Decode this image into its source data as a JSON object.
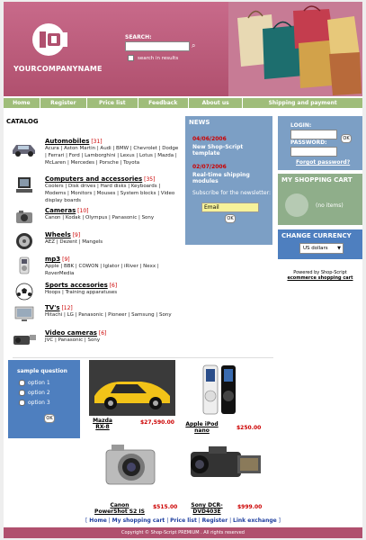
{
  "header": {
    "company": "YOURCOMPANYNAME",
    "search_label": "SEARCH:",
    "search_value": "",
    "search_in_results": "search in results"
  },
  "nav": [
    {
      "label": "Home"
    },
    {
      "label": "Register"
    },
    {
      "label": "Price list"
    },
    {
      "label": "Feedback"
    },
    {
      "label": "About us"
    },
    {
      "label": "Shipping and payment"
    }
  ],
  "catalog": {
    "title": "CATALOG",
    "categories": [
      {
        "name": "Automobiles",
        "count": "[31]",
        "icon": "car-icon",
        "sub": "Acura | Aston Martin | Audi | BMW | Chevrolet | Dodge | Ferrari | Ford | Lamborghini | Lexus | Lotus | Mazda | McLaren | Mercedes | Porsche | Toyota"
      },
      {
        "name": "Computers and accessories",
        "count": "[35]",
        "icon": "computer-icon",
        "sub": "Coolers | Disk drives | Hard disks | Keyboards | Modems | Monitors | Mouses | System blocks | Video display boards"
      },
      {
        "name": "Cameras",
        "count": "[10]",
        "icon": "camera-icon",
        "sub": "Canon | Kodak | Olympus | Panasonic | Sony"
      },
      {
        "name": "Wheels",
        "count": "[9]",
        "icon": "wheel-icon",
        "sub": "AEZ | Dezent | Mangels"
      },
      {
        "name": "mp3",
        "count": "[9]",
        "icon": "mp3-player-icon",
        "sub": "Apple | BBK | COWON | Iglator | iRiver | Nexx | RoverMedia"
      },
      {
        "name": "Sports accesories",
        "count": "[6]",
        "icon": "soccer-ball-icon",
        "sub": "Hoops | Training apparatuses"
      },
      {
        "name": "TV's",
        "count": "[12]",
        "icon": "tv-icon",
        "sub": "Hitachi | LG | Panasonic | Pioneer | Samsung | Sony"
      },
      {
        "name": "Video cameras",
        "count": "[6]",
        "icon": "video-camera-icon",
        "sub": "JVC | Panasonic | Sony"
      }
    ]
  },
  "news": {
    "title": "NEWS",
    "items": [
      {
        "date": "04/06/2006",
        "text": "New Shop-Script template"
      },
      {
        "date": "02/07/2006",
        "text": "Real-time shipping modules"
      }
    ],
    "subscribe_label": "Subscribe for the newsletter:",
    "email_value": "Email",
    "ok": "OK"
  },
  "login": {
    "login_label": "LOGIN:",
    "password_label": "PASSWORD:",
    "ok": "OK",
    "forgot": "Forgot password?"
  },
  "cart": {
    "title": "MY SHOPPING CART",
    "empty": "(no items)"
  },
  "currency": {
    "title": "CHANGE CURRENCY",
    "selected": "US dollars"
  },
  "powered": {
    "text": "Powered by Shop-Script",
    "link": "ecommerce shopping cart"
  },
  "poll": {
    "title": "sample question",
    "options": [
      "option 1",
      "option 2",
      "option 3"
    ],
    "ok": "OK"
  },
  "products": [
    {
      "name": "Mazda RX-8",
      "price": "$27,590.00",
      "icon": "yellow-car-image"
    },
    {
      "name": "Apple iPod nano",
      "price": "$250.00",
      "icon": "ipod-image"
    },
    {
      "name": "Canon PowerShot S2 IS",
      "price": "$515.00",
      "icon": "camera-image"
    },
    {
      "name": "Sony DCR-DVD403E",
      "price": "$999.00",
      "icon": "camcorder-image"
    }
  ],
  "footer": {
    "links": [
      "Home",
      "My shopping cart",
      "Price list",
      "Register",
      "Link exchange"
    ],
    "copyright": "Copyright © Shop-Script PREMIUM . All rights reserved"
  },
  "colors": {
    "header": "#b0506e",
    "nav": "#9fbd7a",
    "news": "#7c9fc5",
    "cart": "#8fae8a",
    "currency": "#4e7fbf",
    "price": "#cc0000"
  }
}
